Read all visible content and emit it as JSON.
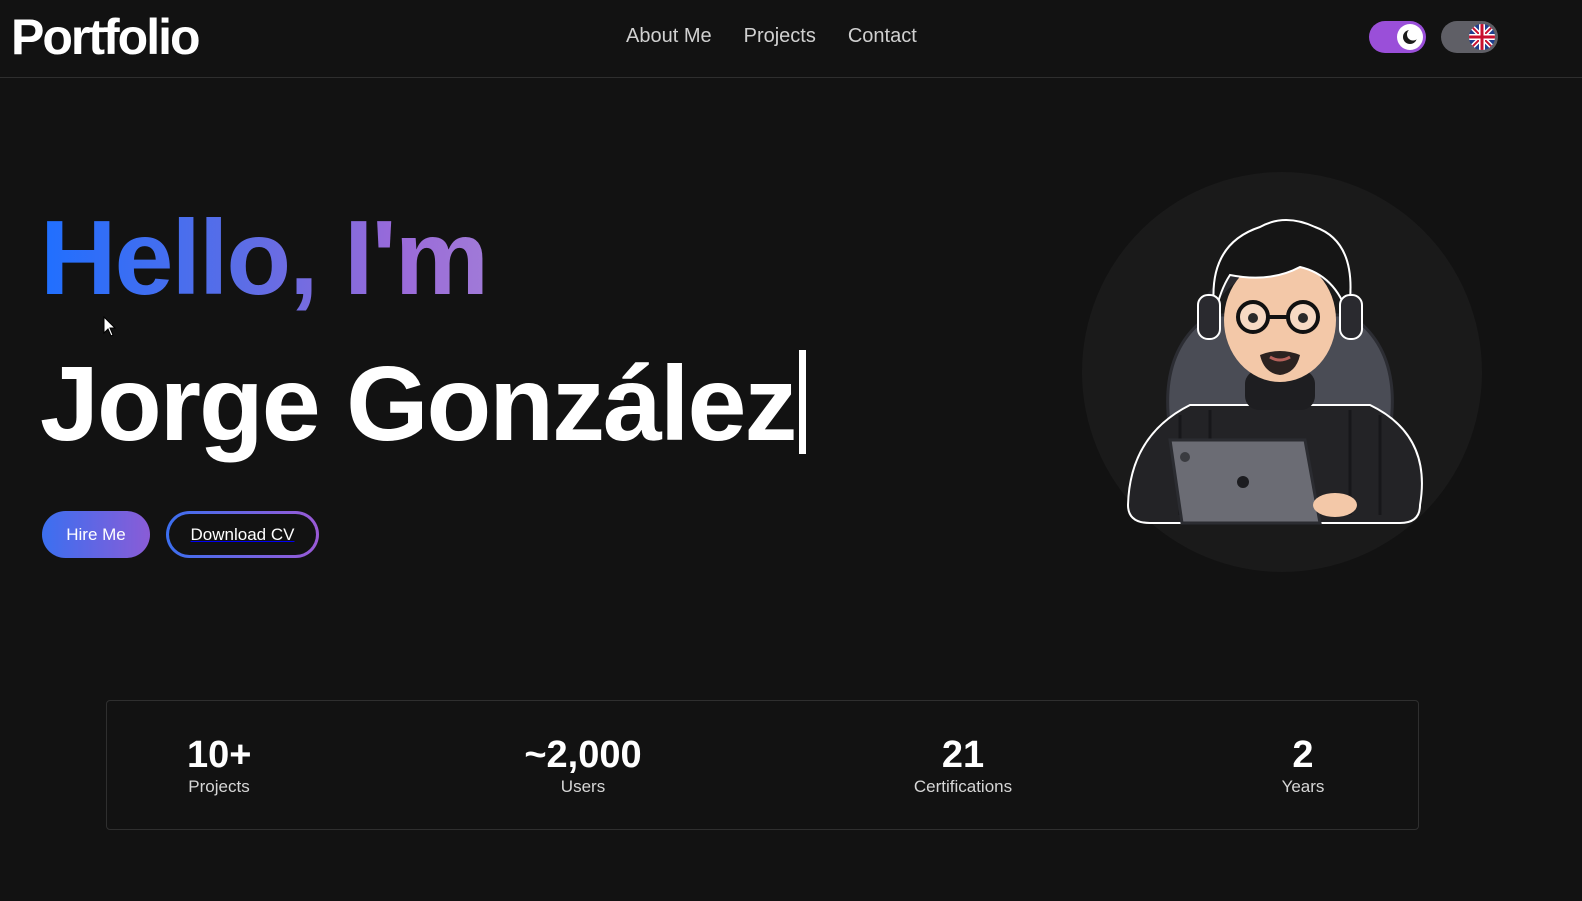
{
  "header": {
    "logo": "Portfolio",
    "nav": [
      {
        "label": "About Me"
      },
      {
        "label": "Projects"
      },
      {
        "label": "Contact"
      }
    ],
    "theme_toggle": {
      "mode": "dark",
      "icon": "moon-icon"
    },
    "language_toggle": {
      "icon": "uk-flag-icon"
    }
  },
  "hero": {
    "greeting": "Hello, I'm",
    "name": "Jorge González",
    "hire_button": "Hire Me",
    "cv_button": "Download CV",
    "avatar": "developer-avatar-illustration"
  },
  "stats": [
    {
      "value": "10+",
      "label": "Projects"
    },
    {
      "value": "~2,000",
      "label": "Users"
    },
    {
      "value": "21",
      "label": "Certifications"
    },
    {
      "value": "2",
      "label": "Years"
    }
  ],
  "colors": {
    "background": "#121212",
    "accent_blue": "#1f6fff",
    "accent_purple": "#9a6ad9"
  }
}
